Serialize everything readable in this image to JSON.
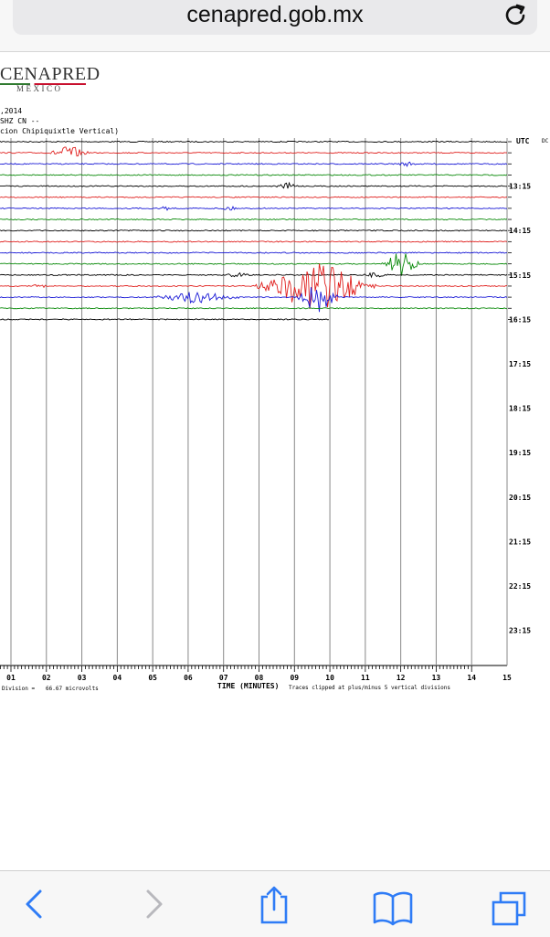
{
  "browser": {
    "url": "cenapred.gob.mx"
  },
  "logo": {
    "name": "CENAPRED",
    "country": "MÉXICO"
  },
  "header_lines": [
    ",2014",
    "SHZ CN --",
    "cion Chipiquixtle Vertical)"
  ],
  "utc_label": "UTC",
  "edge_label": "DC",
  "time_labels": [
    "13:15",
    "14:15",
    "15:15",
    "16:15",
    "17:15",
    "18:15",
    "19:15",
    "20:15",
    "21:15",
    "22:15",
    "23:15"
  ],
  "x_ticks": [
    "01",
    "02",
    "03",
    "04",
    "05",
    "06",
    "07",
    "08",
    "09",
    "10",
    "11",
    "12",
    "13",
    "14",
    "15"
  ],
  "footer": {
    "left_text": "Division =",
    "microvolts_text": "66.67 microvolts",
    "axis_title": "TIME (MINUTES)",
    "clip_text": "Traces clipped at plus/minus 5 vertical divisions"
  },
  "trace_colors": [
    "#000000",
    "#e0201e",
    "#1a1ad6",
    "#0a8a0a"
  ],
  "toolbar": {
    "back": "back-icon",
    "forward": "forward-icon",
    "share": "share-icon",
    "bookmarks": "book-icon",
    "tabs": "tabs-icon"
  }
}
